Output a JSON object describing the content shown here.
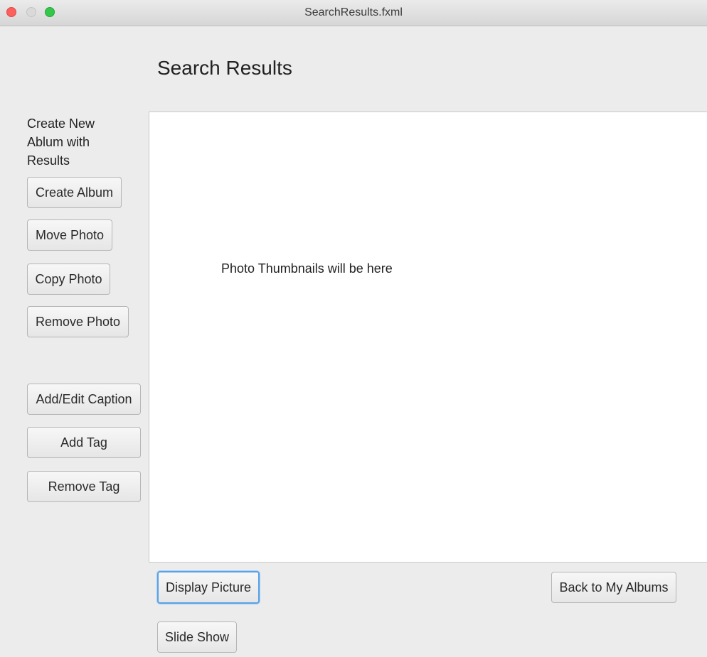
{
  "window": {
    "title": "SearchResults.fxml"
  },
  "header": {
    "title": "Search Results"
  },
  "sidebar": {
    "label": "Create New Ablum with Results",
    "buttons": {
      "create_album": "Create Album",
      "move_photo": "Move Photo",
      "copy_photo": "Copy Photo",
      "remove_photo": "Remove Photo",
      "add_edit_caption": "Add/Edit Caption",
      "add_tag": "Add Tag",
      "remove_tag": "Remove Tag"
    }
  },
  "main": {
    "placeholder": "Photo Thumbnails will be here"
  },
  "footer": {
    "display_picture": "Display Picture",
    "back_to_albums": "Back to My Albums",
    "slide_show": "Slide Show"
  },
  "colors": {
    "close": "#fc605c",
    "minimize": "#d9d9d9",
    "maximize": "#34c84a",
    "focus_ring": "#5aa2e6"
  }
}
